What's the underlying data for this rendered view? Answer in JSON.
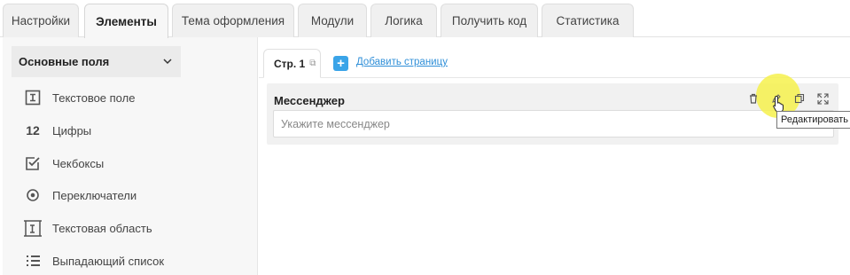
{
  "tabs": [
    {
      "label": "Настройки"
    },
    {
      "label": "Элементы"
    },
    {
      "label": "Тема оформления"
    },
    {
      "label": "Модули"
    },
    {
      "label": "Логика"
    },
    {
      "label": "Получить код"
    },
    {
      "label": "Статистика"
    }
  ],
  "active_tab": "Элементы",
  "sidebar": {
    "section_title": "Основные поля",
    "items": [
      {
        "label": "Текстовое поле",
        "icon": "text-field-icon"
      },
      {
        "label": "Цифры",
        "icon": "numbers-icon",
        "icon_text": "12"
      },
      {
        "label": "Чекбоксы",
        "icon": "checkbox-icon"
      },
      {
        "label": "Переключатели",
        "icon": "radio-icon"
      },
      {
        "label": "Текстовая область",
        "icon": "textarea-icon"
      },
      {
        "label": "Выпадающий список",
        "icon": "list-icon"
      }
    ]
  },
  "pages": {
    "current_page": "Стр. 1",
    "add_page_label": "Добавить страницу"
  },
  "field": {
    "label": "Мессенджер",
    "placeholder": "Укажите мессенджер"
  },
  "tooltip": "Редактировать",
  "colors": {
    "accent": "#3aa4e8",
    "link": "#2f8fd8",
    "highlight": "#f5f046"
  }
}
